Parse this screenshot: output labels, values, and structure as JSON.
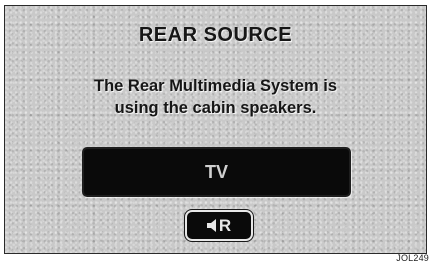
{
  "screen": {
    "title": "REAR SOURCE",
    "message_line1": "The Rear Multimedia System is",
    "message_line2": "using the cabin speakers."
  },
  "buttons": {
    "tv_label": "TV",
    "rear_label": "R",
    "rear_icon": "speaker-icon"
  },
  "figure": {
    "ref_code": "JOL249"
  },
  "colors": {
    "screen_background": "#c9c9c9",
    "button_background": "#0a0a0a",
    "text": "#161616"
  }
}
